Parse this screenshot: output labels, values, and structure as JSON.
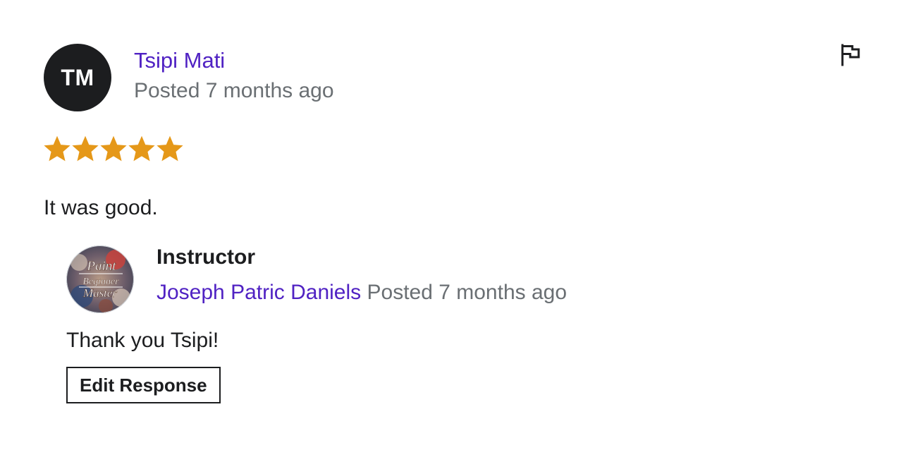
{
  "review": {
    "avatar_initials": "TM",
    "author_name": "Tsipi Mati",
    "posted_text": "Posted 7 months ago",
    "rating": 5,
    "rating_max": 5,
    "text": "It was good.",
    "flag_icon": "flag-icon"
  },
  "response": {
    "role_label": "Instructor",
    "instructor_name": "Joseph Patric Daniels",
    "posted_text": "Posted 7 months ago",
    "text": "Thank you Tsipi!",
    "edit_button_label": "Edit Response",
    "avatar_logo_text": [
      "Paint",
      "Beginner",
      "Master"
    ]
  },
  "colors": {
    "link_purple": "#5022c3",
    "star_orange": "#e59819",
    "muted_gray": "#6a6f73",
    "text_dark": "#1c1d1f"
  }
}
